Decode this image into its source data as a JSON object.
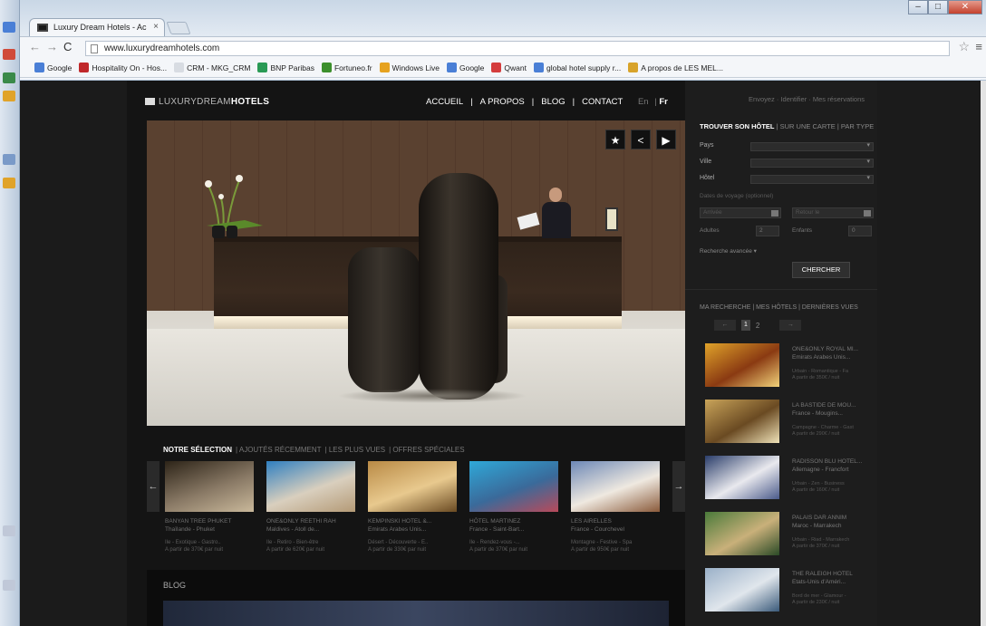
{
  "browser": {
    "tab_title": "Luxury Dream Hotels - Ac",
    "tab_close": "×",
    "url": "www.luxurydreamhotels.com",
    "back": "←",
    "forward": "→",
    "reload": "C",
    "star_icon": "☆",
    "menu_icon": "≡",
    "window_controls": [
      "–",
      "□",
      "✕"
    ],
    "bookmarks": [
      {
        "label": "Google",
        "color": "#4a7fd6"
      },
      {
        "label": "Hospitality On - Hos...",
        "color": "#c0282a"
      },
      {
        "label": "CRM - MKG_CRM",
        "color": "#d8dce2"
      },
      {
        "label": "BNP Paribas",
        "color": "#2a9a55"
      },
      {
        "label": "Fortuneo.fr",
        "color": "#3c8f2c"
      },
      {
        "label": "Windows Live",
        "color": "#e6a21f"
      },
      {
        "label": "Google",
        "color": "#4a7fd6"
      },
      {
        "label": "Qwant",
        "color": "#d43d3d"
      },
      {
        "label": "global hotel supply r...",
        "color": "#4a7fd6"
      },
      {
        "label": "A propos de LES MEL...",
        "color": "#d8a32a"
      }
    ]
  },
  "site": {
    "logo_light": "LUXURYDREAM",
    "logo_bold": "HOTELS",
    "nav": [
      "ACCUEIL",
      "A PROPOS",
      "BLOG",
      "CONTACT"
    ],
    "nav_sep": "|",
    "lang_en": "En",
    "lang_fr": "Fr",
    "hero_buttons": [
      "★",
      "<",
      "▶"
    ],
    "selection_tabs": [
      "NOTRE SÉLECTION",
      "AJOUTÉS RÉCEMMENT",
      "LES PLUS VUES",
      "OFFRES SPÉCIALES"
    ],
    "carousel_prev": "←",
    "carousel_next": "→",
    "cards": [
      {
        "title": "BANYAN TREE PHUKET",
        "subtitle": "Thaïlande - Phuket",
        "tags": "Ile - Exotique - Gastro..",
        "price": "A partir de 370€ par nuit",
        "colors": [
          "#2d2418",
          "#8a7a66",
          "#c9b89a"
        ]
      },
      {
        "title": "ONE&ONLY REETHI RAH",
        "subtitle": "Maldives - Atoll de...",
        "tags": "Ile - Retiro - Bien-être",
        "price": "A partir de 620€ par nuit",
        "colors": [
          "#2f7fc0",
          "#d9cfbe",
          "#b49a76"
        ]
      },
      {
        "title": "KEMPINSKI HOTEL &...",
        "subtitle": "Emirats Arabes Unis...",
        "tags": "Désert - Découverte - E..",
        "price": "A partir de 330€ par nuit",
        "colors": [
          "#b98a45",
          "#e8c98e",
          "#6a4a22"
        ]
      },
      {
        "title": "HÔTEL MARTINEZ",
        "subtitle": "France - Saint-Bart...",
        "tags": "Ile - Rendez-vous -...",
        "price": "A partir de 370€ par nuit",
        "colors": [
          "#2fa8d8",
          "#3a6a9a",
          "#b94a5a"
        ]
      },
      {
        "title": "LES AIRELLES",
        "subtitle": "France - Courchevel",
        "tags": "Montagne - Festive - Spa",
        "price": "A partir de 950€ par nuit",
        "colors": [
          "#6d88b6",
          "#efe9e0",
          "#8a5a3a"
        ]
      }
    ],
    "blog_label": "BLOG"
  },
  "sidebar": {
    "links": "Envoyez · Identifier · Mes réservations",
    "search_title": "TROUVER SON HÔTEL",
    "search_alt": "SUR UNE CARTE | PAR TYPE",
    "fields": [
      "Pays",
      "Ville",
      "Hôtel"
    ],
    "dates_hint": "Dates de voyage (optionnel)",
    "arrival": "Arrivée",
    "departure": "Retour le",
    "adults": "Adultes",
    "children": "Enfants",
    "adults_val": "2",
    "children_val": "0",
    "advanced": "Recherche avancée ▾",
    "search_button": "CHERCHER",
    "recent_tabs": "MA RECHERCHE | MES HÔTELS | DERNIÈRES VUES",
    "pager_prev": "←",
    "pager_pages": [
      "1",
      "2"
    ],
    "pager_next": "→",
    "recent": [
      {
        "title": "ONE&ONLY ROYAL MI...",
        "subtitle": "Emirats Arabes Unis...",
        "tags": "Urbain - Romantique - Fa",
        "price": "A partir de 350€ / nuit",
        "colors": [
          "#e0a32a",
          "#8a3a12",
          "#f2d27a"
        ]
      },
      {
        "title": "LA BASTIDE DE MOU...",
        "subtitle": "France - Mougins...",
        "tags": "Campagne - Charme - Gast",
        "price": "A partir de 290€ / nuit",
        "colors": [
          "#c9a45a",
          "#6a4a22",
          "#efe2b8"
        ]
      },
      {
        "title": "RADISSON BLU HOTEL...",
        "subtitle": "Allemagne - Francfort",
        "tags": "Urbain - Zen - Business",
        "price": "A partir de 160€ / nuit",
        "colors": [
          "#2a3d6a",
          "#e9e9ee",
          "#4a5a8a"
        ]
      },
      {
        "title": "PALAIS DAR ANNIM",
        "subtitle": "Maroc - Marrakech",
        "tags": "Urbain - Riad - Marrakech",
        "price": "A partir de 370€ / nuit",
        "colors": [
          "#4a7a3a",
          "#c9b07a",
          "#2a4a26"
        ]
      },
      {
        "title": "THE RALEIGH HOTEL",
        "subtitle": "Etats-Unis d'Améri...",
        "tags": "Bord de mer - Glamour -",
        "price": "A partir de 230€ / nuit",
        "colors": [
          "#9ab0c8",
          "#e0e6ec",
          "#3a5a7a"
        ]
      }
    ]
  }
}
